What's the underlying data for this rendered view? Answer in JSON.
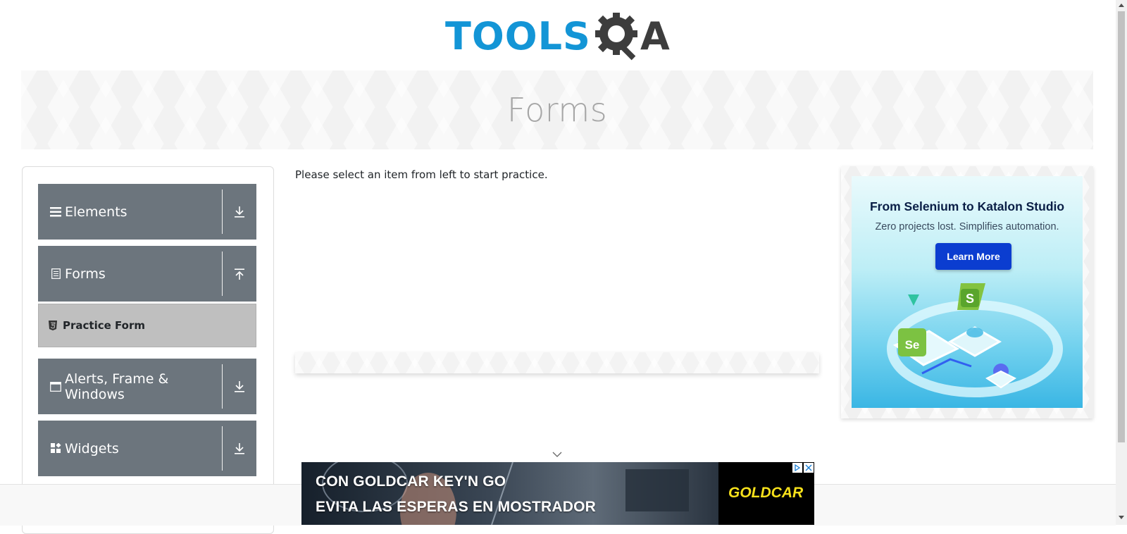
{
  "header": {
    "logo_left": "TOOLS",
    "logo_right": "A"
  },
  "banner": {
    "title": "Forms"
  },
  "sidebar": {
    "groups": [
      {
        "label": "Elements",
        "icon": "hamburger-icon",
        "arrow": "download-arrow-icon",
        "expanded": false
      },
      {
        "label": "Forms",
        "icon": "document-icon",
        "arrow": "upload-arrow-icon",
        "expanded": true
      },
      {
        "label": "Alerts, Frame & Windows",
        "icon": "window-icon",
        "arrow": "download-arrow-icon",
        "expanded": false
      },
      {
        "label": "Widgets",
        "icon": "widgets-icon",
        "arrow": "download-arrow-icon",
        "expanded": false
      }
    ],
    "sub_items": [
      {
        "label": "Practice Form",
        "icon": "html5-icon"
      }
    ]
  },
  "main": {
    "message": "Please select an item from left to start practice."
  },
  "right_ad": {
    "title": "From Selenium to Katalon Studio",
    "subtitle": "Zero projects lost. Simplifies automation.",
    "button": "Learn More"
  },
  "bottom_ad": {
    "line1": "CON GOLDCAR KEY'N GO",
    "line2": "EVITA LAS ESPERAS EN MOSTRADOR",
    "brand": "GOLDCAR"
  },
  "colors": {
    "brand_blue": "#1395d6",
    "brand_dark": "#3d3d3d",
    "sidebar_header": "#6c757d",
    "sidebar_active": "#bfbfbf",
    "ad_button": "#0b3dd0",
    "goldcar_yellow": "#f7e11b"
  }
}
